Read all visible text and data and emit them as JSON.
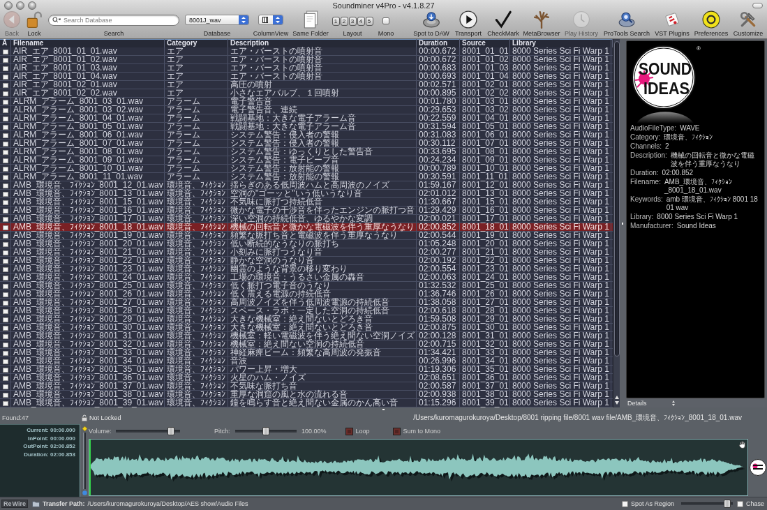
{
  "window": {
    "title": "Soundminer v4Pro - v4.1.8.27"
  },
  "toolbar": {
    "left": [
      {
        "kind": "back",
        "label": "Back",
        "disabled": true
      },
      {
        "kind": "lock",
        "label": "Lock",
        "disabled": false
      },
      {
        "kind": "search",
        "label": "Search",
        "placeholder": "Search Database"
      },
      {
        "kind": "database",
        "label": "Database",
        "value": "8001J_wav"
      },
      {
        "kind": "columnview",
        "label": "ColumnView"
      },
      {
        "kind": "samefolder",
        "label": "Same Folder",
        "disabled": false
      },
      {
        "kind": "layout",
        "label": "Layout",
        "buttons": [
          "1",
          "2",
          "3",
          "4",
          "5"
        ]
      },
      {
        "kind": "mono",
        "label": "Mono",
        "checked": false
      }
    ],
    "right": [
      {
        "kind": "spot",
        "label": "Spot to DAW",
        "disabled": false
      },
      {
        "kind": "transport",
        "label": "Transport",
        "disabled": false
      },
      {
        "kind": "checkmark",
        "label": "CheckMark",
        "disabled": false
      },
      {
        "kind": "metabrowser",
        "label": "MetaBrowser",
        "disabled": false
      },
      {
        "kind": "history",
        "label": "Play History",
        "disabled": true
      },
      {
        "kind": "protools",
        "label": "ProTools Search",
        "disabled": false
      },
      {
        "kind": "vst",
        "label": "VST Plugins",
        "disabled": false
      },
      {
        "kind": "preferences",
        "label": "Preferences",
        "disabled": false
      },
      {
        "kind": "customize",
        "label": "Customize",
        "disabled": false
      }
    ]
  },
  "table": {
    "check_column": "Ā",
    "columns": [
      "Filename",
      "Category",
      "Description",
      "Duration",
      "Source",
      "Library"
    ],
    "rows": [
      {
        "checked": false,
        "selected": false,
        "cells": [
          "AIR_エア_8001_01_01.wav",
          "エア",
          "エア・バーストの噴射音",
          "00:00.672",
          "8001_01_01",
          "8000 Series Sci Fi Warp 1"
        ]
      },
      {
        "checked": false,
        "selected": false,
        "cells": [
          "AIR_エア_8001_01_02.wav",
          "エア",
          "エア・バーストの噴射音",
          "00:00.672",
          "8001_01_02",
          "8000 Series Sci Fi Warp 1"
        ]
      },
      {
        "checked": false,
        "selected": false,
        "cells": [
          "AIR_エア_8001_01_03.wav",
          "エア",
          "エア・バーストの噴射音",
          "00:00.683",
          "8001_01_03",
          "8000 Series Sci Fi Warp 1"
        ]
      },
      {
        "checked": false,
        "selected": false,
        "cells": [
          "AIR_エア_8001_01_04.wav",
          "エア",
          "エア・バーストの噴射音",
          "00:00.693",
          "8001_01_04",
          "8000 Series Sci Fi Warp 1"
        ]
      },
      {
        "checked": false,
        "selected": false,
        "cells": [
          "AIR_エア_8001_02_01.wav",
          "エア",
          "高圧の噴射",
          "00:02.571",
          "8001_02_01",
          "8000 Series Sci Fi Warp 1"
        ]
      },
      {
        "checked": false,
        "selected": false,
        "cells": [
          "AIR_エア_8001_02_02.wav",
          "エア",
          "小さなエアバルブ、１回噴射",
          "00:00.895",
          "8001_02_02",
          "8000 Series Sci Fi Warp 1"
        ]
      },
      {
        "checked": false,
        "selected": false,
        "cells": [
          "ALRM_アラーム_8001_03_01.wav",
          "アラーム",
          "電子警告音",
          "00:01.780",
          "8001_03_01",
          "8000 Series Sci Fi Warp 1"
        ]
      },
      {
        "checked": false,
        "selected": false,
        "cells": [
          "ALRM_アラーム_8001_03_02.wav",
          "アラーム",
          "電子警告音、連続",
          "00:29.653",
          "8001_03_02",
          "8000 Series Sci Fi Warp 1"
        ]
      },
      {
        "checked": false,
        "selected": false,
        "cells": [
          "ALRM_アラーム_8001_04_01.wav",
          "アラーム",
          "戦闘基地：大きな電子アラーム音",
          "00:22.559",
          "8001_04_01",
          "8000 Series Sci Fi Warp 1"
        ]
      },
      {
        "checked": false,
        "selected": false,
        "cells": [
          "ALRM_アラーム_8001_05_01.wav",
          "アラーム",
          "戦闘基地：大きな電子アラーム音",
          "00:31.594",
          "8001_05_01",
          "8000 Series Sci Fi Warp 1"
        ]
      },
      {
        "checked": false,
        "selected": false,
        "cells": [
          "ALRM_アラーム_8001_06_01.wav",
          "アラーム",
          "システム警告：侵入者の警報",
          "00:31.083",
          "8001_06_01",
          "8000 Series Sci Fi Warp 1"
        ]
      },
      {
        "checked": false,
        "selected": false,
        "cells": [
          "ALRM_アラーム_8001_07_01.wav",
          "アラーム",
          "システム警告：侵入者の警報",
          "00:30.112",
          "8001_07_01",
          "8000 Series Sci Fi Warp 1"
        ]
      },
      {
        "checked": false,
        "selected": false,
        "cells": [
          "ALRM_アラーム_8001_08_01.wav",
          "アラーム",
          "システム警告：ゆっくりとした警告音",
          "00:33.695",
          "8001_08_01",
          "8000 Series Sci Fi Warp 1"
        ]
      },
      {
        "checked": false,
        "selected": false,
        "cells": [
          "ALRM_アラーム_8001_09_01.wav",
          "アラーム",
          "システム警告：電子ビープ音",
          "00:24.234",
          "8001_09_01",
          "8000 Series Sci Fi Warp 1"
        ]
      },
      {
        "checked": false,
        "selected": false,
        "cells": [
          "ALRM_アラーム_8001_10_01.wav",
          "アラーム",
          "システム警告：放射能の警報",
          "00:00.789",
          "8001_10_01",
          "8000 Series Sci Fi Warp 1"
        ]
      },
      {
        "checked": false,
        "selected": false,
        "cells": [
          "ALRM_アラーム_8001_11_01.wav",
          "アラーム",
          "システム警告：放射能の警報",
          "00:30.591",
          "8001_11_01",
          "8000 Series Sci Fi Warp 1"
        ]
      },
      {
        "checked": false,
        "selected": false,
        "cells": [
          "AMB_環境音、ﾌｨｸｼｮﾝ_8001_12_01.wav",
          "環境音、ﾌｨｸｼｮﾝ",
          "揺らぎのある低周波ハムと高周波のノイズ",
          "01:59.167",
          "8001_12_01",
          "8000 Series Sci Fi Warp 1"
        ]
      },
      {
        "checked": false,
        "selected": false,
        "cells": [
          "AMB_環境音、ﾌｨｸｼｮﾝ_8001_13_01.wav",
          "環境音、ﾌｨｸｼｮﾝ",
          "空洞の\"ゴーッと\"いう低いうなり音",
          "02:01.012",
          "8001_13_01",
          "8000 Series Sci Fi Warp 1"
        ]
      },
      {
        "checked": false,
        "selected": false,
        "cells": [
          "AMB_環境音、ﾌｨｸｼｮﾝ_8001_15_01.wav",
          "環境音、ﾌｨｸｼｮﾝ",
          "不気味に脈打つ持続低音",
          "01:30.667",
          "8001_15_01",
          "8000 Series Sci Fi Warp 1"
        ]
      },
      {
        "checked": false,
        "selected": false,
        "cells": [
          "AMB_環境音、ﾌｨｸｼｮﾝ_8001_16_01.wav",
          "環境音、ﾌｨｸｼｮﾝ",
          "微かな電子の干渉音を伴ったエンジンの脈打つ音",
          "01:29.429",
          "8001_16_01",
          "8000 Series Sci Fi Warp 1"
        ]
      },
      {
        "checked": false,
        "selected": false,
        "cells": [
          "AMB_環境音、ﾌｨｸｼｮﾝ_8001_17_01.wav",
          "環境音、ﾌｨｸｼｮﾝ",
          "深い空洞の持続低音、ゆるやかな変調",
          "02:00.021",
          "8001_17_01",
          "8000 Series Sci Fi Warp 1"
        ]
      },
      {
        "checked": false,
        "selected": true,
        "cells": [
          "AMB_環境音、ﾌｨｸｼｮﾝ_8001_18_01.wav",
          "環境音、ﾌｨｸｼｮﾝ",
          "機械の回転音と微かな電磁波を伴う重厚なうなり",
          "02:00.852",
          "8001_18_01",
          "8000 Series Sci Fi Warp 1"
        ]
      },
      {
        "checked": false,
        "selected": false,
        "cells": [
          "AMB_環境音、ﾌｨｸｼｮﾝ_8001_19_01.wav",
          "環境音、ﾌｨｸｼｮﾝ",
          "頻繁な脈打ち音と電磁波を伴う重厚なうなり",
          "02:00.544",
          "8001_19_01",
          "8000 Series Sci Fi Warp 1"
        ]
      },
      {
        "checked": false,
        "selected": false,
        "cells": [
          "AMB_環境音、ﾌｨｸｼｮﾝ_8001_20_01.wav",
          "環境音、ﾌｨｸｼｮﾝ",
          "低い断続的なうなりの脈打ち",
          "01:05.248",
          "8001_20_01",
          "8000 Series Sci Fi Warp 1"
        ]
      },
      {
        "checked": false,
        "selected": false,
        "cells": [
          "AMB_環境音、ﾌｨｸｼｮﾝ_8001_21_01.wav",
          "環境音、ﾌｨｸｼｮﾝ",
          "小刻みに脈打つうなり音",
          "02:00.277",
          "8001_21_01",
          "8000 Series Sci Fi Warp 1"
        ]
      },
      {
        "checked": false,
        "selected": false,
        "cells": [
          "AMB_環境音、ﾌｨｸｼｮﾝ_8001_22_01.wav",
          "環境音、ﾌｨｸｼｮﾝ",
          "静かな空洞のうなり音",
          "02:00.192",
          "8001_22_01",
          "8000 Series Sci Fi Warp 1"
        ]
      },
      {
        "checked": false,
        "selected": false,
        "cells": [
          "AMB_環境音、ﾌｨｸｼｮﾝ_8001_23_01.wav",
          "環境音、ﾌｨｸｼｮﾝ",
          "幽霊のような背景の移り変わり",
          "02:00.554",
          "8001_23_01",
          "8000 Series Sci Fi Warp 1"
        ]
      },
      {
        "checked": false,
        "selected": false,
        "cells": [
          "AMB_環境音、ﾌｨｸｼｮﾝ_8001_24_01.wav",
          "環境音、ﾌｨｸｼｮﾝ",
          "工場の環境音：うるさい金属の轟音",
          "02:00.063",
          "8001_24_01",
          "8000 Series Sci Fi Warp 1"
        ]
      },
      {
        "checked": false,
        "selected": false,
        "cells": [
          "AMB_環境音、ﾌｨｸｼｮﾝ_8001_25_01.wav",
          "環境音、ﾌｨｸｼｮﾝ",
          "低く脈打つ電子音のうなり",
          "01:32.532",
          "8001_25_01",
          "8000 Series Sci Fi Warp 1"
        ]
      },
      {
        "checked": false,
        "selected": false,
        "cells": [
          "AMB_環境音、ﾌｨｸｼｮﾝ_8001_26_01.wav",
          "環境音、ﾌｨｸｼｮﾝ",
          "低く震える電源の持続低音",
          "01:36.746",
          "8001_26_01",
          "8000 Series Sci Fi Warp 1"
        ]
      },
      {
        "checked": false,
        "selected": false,
        "cells": [
          "AMB_環境音、ﾌｨｸｼｮﾝ_8001_27_01.wav",
          "環境音、ﾌｨｸｼｮﾝ",
          "高周波ノイズを伴う低周波電源の持続低音",
          "01:38.058",
          "8001_27_01",
          "8000 Series Sci Fi Warp 1"
        ]
      },
      {
        "checked": false,
        "selected": false,
        "cells": [
          "AMB_環境音、ﾌｨｸｼｮﾝ_8001_28_01.wav",
          "環境音、ﾌｨｸｼｮﾝ",
          "スペース・ラボ：一定した空洞の持続低音",
          "02:00.618",
          "8001_28_01",
          "8000 Series Sci Fi Warp 1"
        ]
      },
      {
        "checked": false,
        "selected": false,
        "cells": [
          "AMB_環境音、ﾌｨｸｼｮﾝ_8001_29_01.wav",
          "環境音、ﾌｨｸｼｮﾝ",
          "大きな機械室：絶え間ないとどろき音",
          "01:59.508",
          "8001_29_01",
          "8000 Series Sci Fi Warp 1"
        ]
      },
      {
        "checked": false,
        "selected": false,
        "cells": [
          "AMB_環境音、ﾌｨｸｼｮﾝ_8001_30_01.wav",
          "環境音、ﾌｨｸｼｮﾝ",
          "大きな機械室：絶え間ないとどろき音",
          "02:00.875",
          "8001_30_01",
          "8000 Series Sci Fi Warp 1"
        ]
      },
      {
        "checked": false,
        "selected": false,
        "cells": [
          "AMB_環境音、ﾌｨｸｼｮﾝ_8001_31_01.wav",
          "環境音、ﾌｨｸｼｮﾝ",
          "機械室：軽い電磁波を伴う絶え間ない空洞ノイズ",
          "02:00.128",
          "8001_31_01",
          "8000 Series Sci Fi Warp 1"
        ]
      },
      {
        "checked": false,
        "selected": false,
        "cells": [
          "AMB_環境音、ﾌｨｸｼｮﾝ_8001_32_01.wav",
          "環境音、ﾌｨｸｼｮﾝ",
          "機械室：絶え間ない空洞の持続低音",
          "02:00.715",
          "8001_32_01",
          "8000 Series Sci Fi Warp 1"
        ]
      },
      {
        "checked": false,
        "selected": false,
        "cells": [
          "AMB_環境音、ﾌｨｸｼｮﾝ_8001_33_01.wav",
          "環境音、ﾌｨｸｼｮﾝ",
          "神経麻痺ビーム：頻繁な高周波の発振音",
          "01:34.421",
          "8001_33_01",
          "8000 Series Sci Fi Warp 1"
        ]
      },
      {
        "checked": false,
        "selected": false,
        "cells": [
          "AMB_環境音、ﾌｨｸｼｮﾝ_8001_34_01.wav",
          "環境音、ﾌｨｸｼｮﾝ",
          "音波",
          "00:26.996",
          "8001_34_01",
          "8000 Series Sci Fi Warp 1"
        ]
      },
      {
        "checked": false,
        "selected": false,
        "cells": [
          "AMB_環境音、ﾌｨｸｼｮﾝ_8001_35_01.wav",
          "環境音、ﾌｨｸｼｮﾝ",
          "パワー上昇・増大",
          "01:19.306",
          "8001_35_01",
          "8000 Series Sci Fi Warp 1"
        ]
      },
      {
        "checked": false,
        "selected": false,
        "cells": [
          "AMB_環境音、ﾌｨｸｼｮﾝ_8001_36_01.wav",
          "環境音、ﾌｨｸｼｮﾝ",
          "火星のハム・ノイズ",
          "02:08.651",
          "8001_36_01",
          "8000 Series Sci Fi Warp 1"
        ]
      },
      {
        "checked": false,
        "selected": false,
        "cells": [
          "AMB_環境音、ﾌｨｸｼｮﾝ_8001_37_01.wav",
          "環境音、ﾌｨｸｼｮﾝ",
          "不気味な脈打ち音",
          "02:00.587",
          "8001_37_01",
          "8000 Series Sci Fi Warp 1"
        ]
      },
      {
        "checked": false,
        "selected": false,
        "cells": [
          "AMB_環境音、ﾌｨｸｼｮﾝ_8001_38_01.wav",
          "環境音、ﾌｨｸｼｮﾝ",
          "重厚な洞窟の風と水の流れる音",
          "02:00.938",
          "8001_38_01",
          "8000 Series Sci Fi Warp 1"
        ]
      },
      {
        "checked": false,
        "selected": false,
        "cells": [
          "AMB_環境音、ﾌｨｸｼｮﾝ_8001_39_01.wav",
          "環境音、ﾌｨｸｼｮﾝ",
          "鐘を鳴らす音と絶え間ない金属のかん高い音",
          "01:15.296",
          "8001_39_01",
          "8000 Series Sci Fi Warp 1"
        ]
      }
    ]
  },
  "details": {
    "logo": {
      "lines": [
        "SOUND",
        "IDEAS"
      ],
      "mark": "®"
    },
    "fields": [
      {
        "label": "AudioFileType:",
        "value": "WAVE"
      },
      {
        "label": "Category:",
        "value": "環境音、ﾌｨｸｼｮﾝ"
      },
      {
        "label": "Channels:",
        "value": "2"
      },
      {
        "label": "Description:",
        "value": "機械の回転音と微かな電磁波を伴う重厚なうなり"
      },
      {
        "label": "Duration:",
        "value": "02:00.852"
      },
      {
        "label": "Filename:",
        "value": "AMB_環境音、ﾌｨｸｼｮﾝ_8001_18_01.wav"
      },
      {
        "label": "Keywords:",
        "value": "amb 環境音、ﾌｨｸｼｮﾝ 8001 18 01 wav"
      },
      {
        "label": "Library:",
        "value": "8000 Series Sci Fi Warp 1"
      },
      {
        "label": "Manufacturer:",
        "value": "Sound Ideas"
      }
    ],
    "footer": "Details"
  },
  "status": {
    "found": "Found:47",
    "lock": "Not Locked",
    "path": "/Users/kuromagurokuroya/Desktop/8001 ripping file/8001 wav file/AMB_環境音、ﾌｨｸｼｮﾝ_8001_18_01.wav"
  },
  "times": [
    "Current: 00:00.000",
    "InPoint: 00:00.000",
    "OutPoint: 02:00.852",
    "Duration: 02:00.853"
  ],
  "controls": {
    "volume": {
      "label": "Volume:",
      "level": 0.9
    },
    "pitch": {
      "label": "Pitch:",
      "level": 0.5,
      "reading": "100.00%"
    },
    "loop": {
      "label": "Loop",
      "checked": false
    },
    "sum_to_mono": {
      "label": "Sum to Mono",
      "checked": false
    }
  },
  "footer": {
    "rewire": [
      "Re",
      "Wire"
    ],
    "transfer_label": "Transfer Path:",
    "transfer_path": "/Users/kuromagurokuroya/Desktop/AES show/Audio Files",
    "spot_as_region": {
      "label": "Spot As Region",
      "checked": false
    },
    "slider": {
      "level": 0.96
    },
    "chase": {
      "label": "Chase",
      "checked": false
    }
  }
}
